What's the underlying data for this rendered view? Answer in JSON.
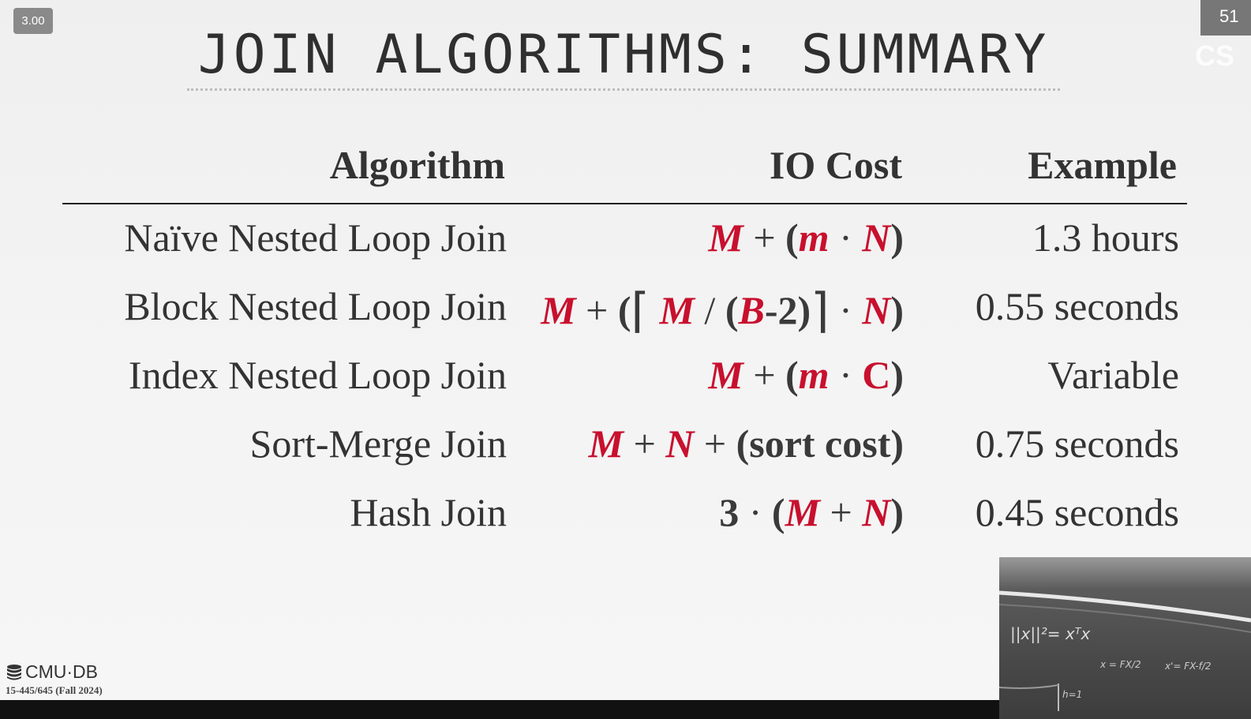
{
  "player": {
    "speed": "3.00"
  },
  "slide": {
    "number": "51",
    "course_ghost": "CS",
    "title": "JOIN ALGORITHMS: SUMMARY",
    "headers": {
      "algorithm": "Algorithm",
      "io_cost": "IO Cost",
      "example": "Example"
    },
    "rows": [
      {
        "algorithm": "Naïve Nested Loop Join",
        "example": "1.3 hours"
      },
      {
        "algorithm": "Block Nested Loop Join",
        "example": "0.55 seconds"
      },
      {
        "algorithm": "Index Nested Loop Join",
        "example": "Variable"
      },
      {
        "algorithm": "Sort-Merge Join",
        "example": "0.75 seconds"
      },
      {
        "algorithm": "Hash Join",
        "example": "0.45 seconds"
      }
    ],
    "costs": {
      "naive": {
        "M": "M",
        "plus": "+",
        "open": "(",
        "m": "m",
        "dot": "·",
        "N": "N",
        "close": ")"
      },
      "block": {
        "M": "M",
        "plus": "+",
        "open": "(",
        "lceil": "⌈",
        "M2": "M",
        "slash": "/",
        "open2": "(",
        "B": "B",
        "minus2": "-2",
        "close2": ")",
        "rceil": "⌉",
        "dot": "·",
        "N": "N",
        "close": ")"
      },
      "index": {
        "M": "M",
        "plus": "+",
        "open": "(",
        "m": "m",
        "dot": "·",
        "C": "C",
        "close": ")"
      },
      "sortmerge": {
        "M": "M",
        "plus1": "+",
        "N": "N",
        "plus2": "+",
        "rest": "(sort cost)"
      },
      "hash": {
        "three": "3",
        "dot": "·",
        "open": "(",
        "M": "M",
        "plus": "+",
        "N": "N",
        "close": ")"
      }
    },
    "footer": {
      "logo_text": "CMU·DB",
      "course": "15-445/645 (Fall 2024)"
    }
  },
  "colors": {
    "accent": "#c8102e",
    "text": "#333333"
  },
  "webcam": {
    "icon": "chalkboard-video"
  }
}
